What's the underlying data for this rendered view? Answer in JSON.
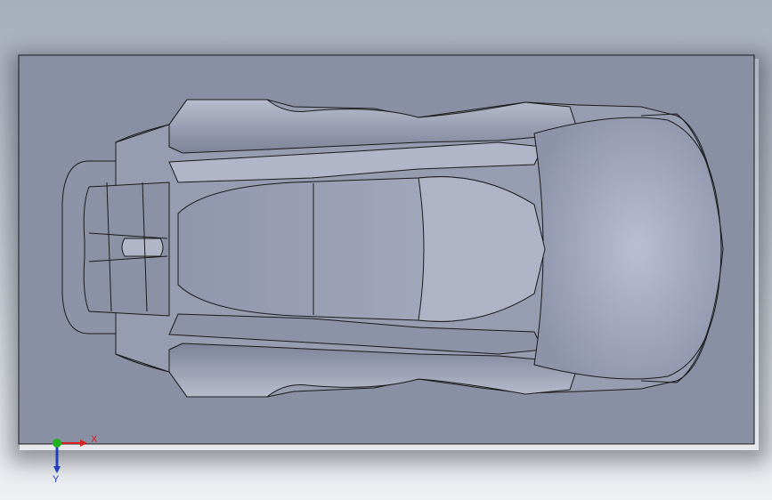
{
  "viewport": {
    "background_top": "#a6aebb",
    "background_bottom": "#eef0f3",
    "model": "car-body-top-view",
    "plate_color": "#8a90a4",
    "body_color": "#a3a9bd",
    "edge_color": "#1a1a1a"
  },
  "triad": {
    "x_label": "X",
    "y_label": "Y",
    "x_color": "#d42020",
    "y_color": "#2040c0",
    "origin_color": "#20b020"
  }
}
